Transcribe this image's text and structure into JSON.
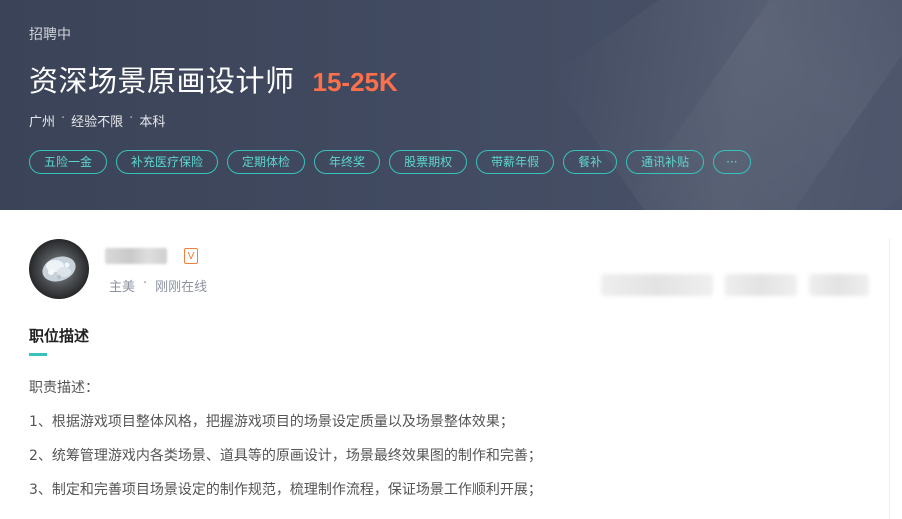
{
  "header": {
    "status": "招聘中",
    "title": "资深场景原画设计师",
    "salary": "15-25K",
    "meta": {
      "city": "广州",
      "experience": "经验不限",
      "education": "本科",
      "separator": "·"
    },
    "tags": [
      "五险一金",
      "补充医疗保险",
      "定期体检",
      "年终奖",
      "股票期权",
      "带薪年假",
      "餐补",
      "通讯补贴",
      "···"
    ]
  },
  "recruiter": {
    "verified_badge": "V",
    "role": "主美",
    "separator": "·",
    "online_status": "刚刚在线"
  },
  "section": {
    "title": "职位描述",
    "lines": [
      "职责描述：",
      "1、根据游戏项目整体风格，把握游戏项目的场景设定质量以及场景整体效果；",
      "2、统筹管理游戏内各类场景、道具等的原画设计，场景最终效果图的制作和完善；",
      "3、制定和完善项目场景设定的制作规范，梳理制作流程，保证场景工作顺利开展；"
    ]
  },
  "colors": {
    "banner_bg": "#414a60",
    "salary": "#fe6f4b",
    "accent_teal": "#37c2bc",
    "verified_orange": "#f0803c"
  },
  "icons": {
    "avatar": "avatar-image",
    "verified": "verified-badge-icon",
    "more": "more-dots-icon"
  }
}
